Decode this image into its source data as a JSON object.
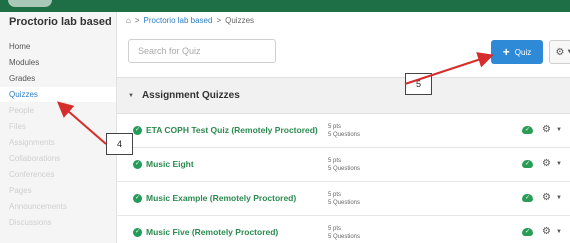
{
  "sidebar": {
    "course_title": "Proctorio lab based",
    "items": [
      {
        "label": "Home",
        "state": "enabled"
      },
      {
        "label": "Modules",
        "state": "enabled"
      },
      {
        "label": "Grades",
        "state": "enabled"
      },
      {
        "label": "Quizzes",
        "state": "active"
      },
      {
        "label": "People",
        "state": "disabled"
      },
      {
        "label": "Files",
        "state": "disabled"
      },
      {
        "label": "Assignments",
        "state": "disabled"
      },
      {
        "label": "Collaborations",
        "state": "disabled"
      },
      {
        "label": "Conferences",
        "state": "disabled"
      },
      {
        "label": "Pages",
        "state": "disabled"
      },
      {
        "label": "Announcements",
        "state": "disabled"
      },
      {
        "label": "Discussions",
        "state": "disabled"
      }
    ]
  },
  "breadcrumb": {
    "home_glyph": "⌂",
    "sep1": ">",
    "course": "Proctorio lab based",
    "sep2": ">",
    "current": "Quizzes"
  },
  "search": {
    "placeholder": "Search for Quiz"
  },
  "toolbar": {
    "add_label": "Quiz",
    "plus_glyph": "+"
  },
  "group": {
    "title": "Assignment Quizzes",
    "toggle_glyph": "▼"
  },
  "quizzes": [
    {
      "name": "ETA COPH Test Quiz (Remotely Proctored)",
      "points": "5 pts",
      "questions": "5 Questions"
    },
    {
      "name": "Music Eight",
      "points": "5 pts",
      "questions": "5 Questions"
    },
    {
      "name": "Music Example (Remotely Proctored)",
      "points": "5 pts",
      "questions": "5 Questions"
    },
    {
      "name": "Music Five (Remotely Proctored)",
      "points": "5 pts",
      "questions": "5 Questions"
    }
  ],
  "callouts": {
    "four": "4",
    "five": "5"
  },
  "icons": {
    "home": "home-icon",
    "quiz": "quiz-rocket-icon",
    "published": "cloud-check-icon",
    "settings": "gear-icon",
    "caret": "chevron-down-icon"
  },
  "colors": {
    "topbar": "#1e6f45",
    "primary_button": "#2e8ad6",
    "link": "#2c7ec5",
    "quiz_title": "#2b8a4f",
    "published": "#2a9d55",
    "annotation_arrow": "#d62c2c"
  }
}
